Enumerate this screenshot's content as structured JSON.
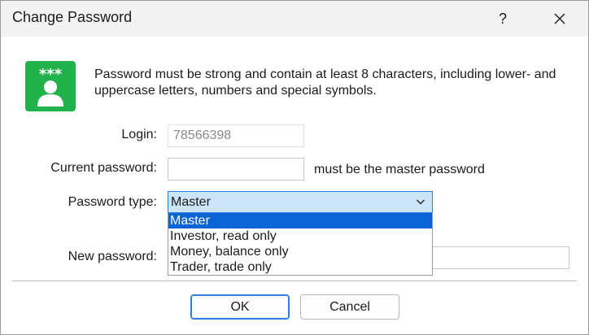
{
  "window": {
    "title": "Change Password",
    "help_glyph": "?",
    "close_glyph": "✕"
  },
  "intro": {
    "text": "Password must be strong and contain at least 8 characters, including lower- and uppercase letters, numbers and special symbols.",
    "icon": "user-password-icon",
    "icon_stars": "***",
    "icon_color": "#21b24b"
  },
  "form": {
    "login_label": "Login:",
    "login_value": "78566398",
    "current_password_label": "Current password:",
    "current_password_value": "",
    "current_password_hint": "must be the master password",
    "password_type_label": "Password type:",
    "password_type_value": "Master",
    "password_type_options": [
      "Master",
      "Investor, read only",
      "Money, balance only",
      "Trader, trade only"
    ],
    "new_password_label": "New password:",
    "new_password_value": ""
  },
  "buttons": {
    "ok": "OK",
    "cancel": "Cancel"
  },
  "colors": {
    "accent": "#0a64d6",
    "select_highlight": "#cce4f7",
    "focus_border": "#2f7fdc"
  }
}
